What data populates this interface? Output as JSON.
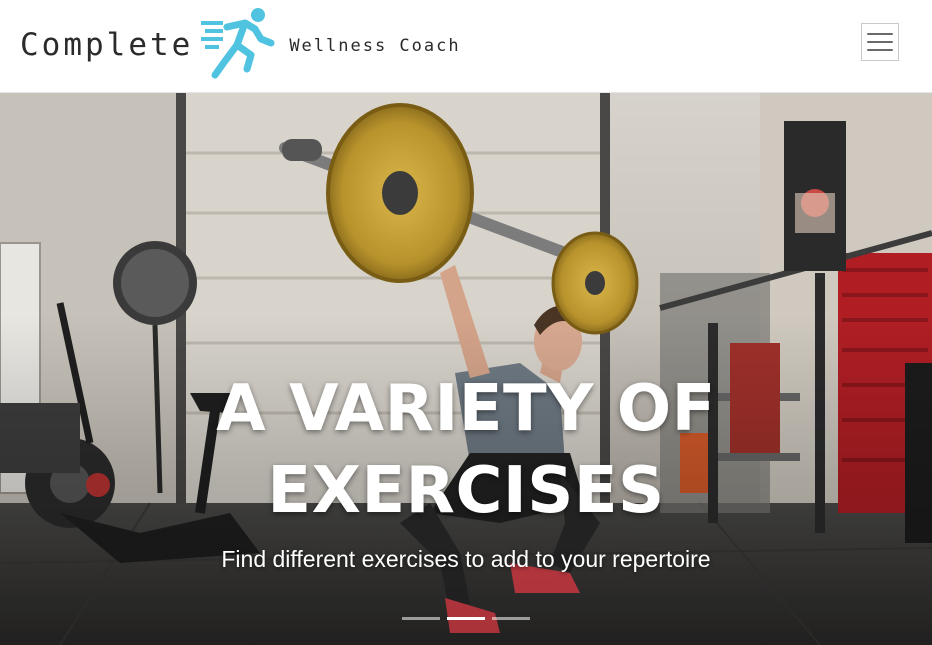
{
  "header": {
    "logo": {
      "word": "Complete",
      "tagline": "Wellness Coach",
      "icon": "running-person-icon",
      "icon_color": "#4fc3e0"
    },
    "menu_icon": "hamburger-menu-icon"
  },
  "carousel": {
    "title": "A VARIETY OF EXERCISES",
    "subtitle": "Find different exercises to add to your repertoire",
    "slide_count": 3,
    "active_index": 1
  },
  "colors": {
    "text_dark": "#2b2b2b",
    "accent": "#4fc3e0",
    "hero_text": "#ffffff"
  }
}
